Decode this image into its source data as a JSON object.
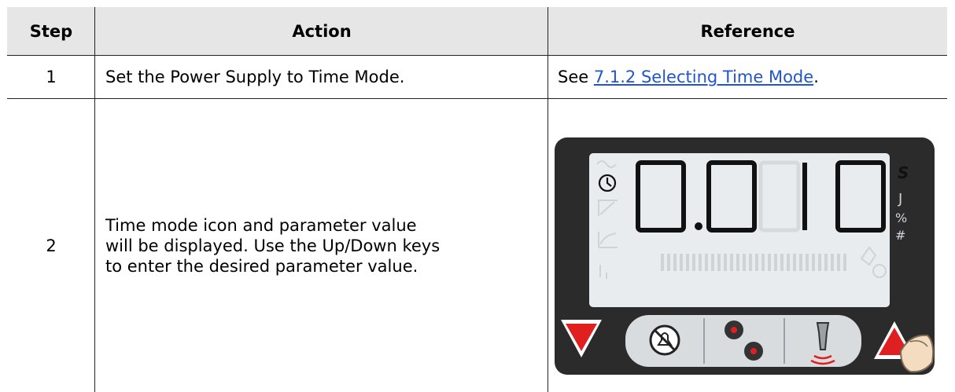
{
  "headers": {
    "step": "Step",
    "action": "Action",
    "reference": "Reference"
  },
  "rows": [
    {
      "step": "1",
      "action": "Set the Power Supply to Time Mode.",
      "ref_prefix": "See ",
      "ref_link": "7.1.2 Selecting Time Mode",
      "ref_suffix": "."
    },
    {
      "step": "2",
      "action_lines": [
        "Time mode icon and parameter value",
        "will be displayed. Use the Up/Down keys",
        "to enter the desired parameter value."
      ]
    }
  ],
  "display": {
    "digits": "0.010",
    "unit": "S",
    "ghost_units": [
      "J",
      "%",
      "#"
    ]
  },
  "colors": {
    "header_bg": "#e6e6e6",
    "link": "#2255cc",
    "panel": "#2b2b2b",
    "lcd": "#e9ecee",
    "arrow": "#e02020"
  },
  "icons": [
    "clock-icon",
    "alarm-cancel-icon",
    "gears-icon",
    "horn-icon",
    "down-arrow-icon",
    "up-arrow-icon",
    "finger-icon"
  ]
}
